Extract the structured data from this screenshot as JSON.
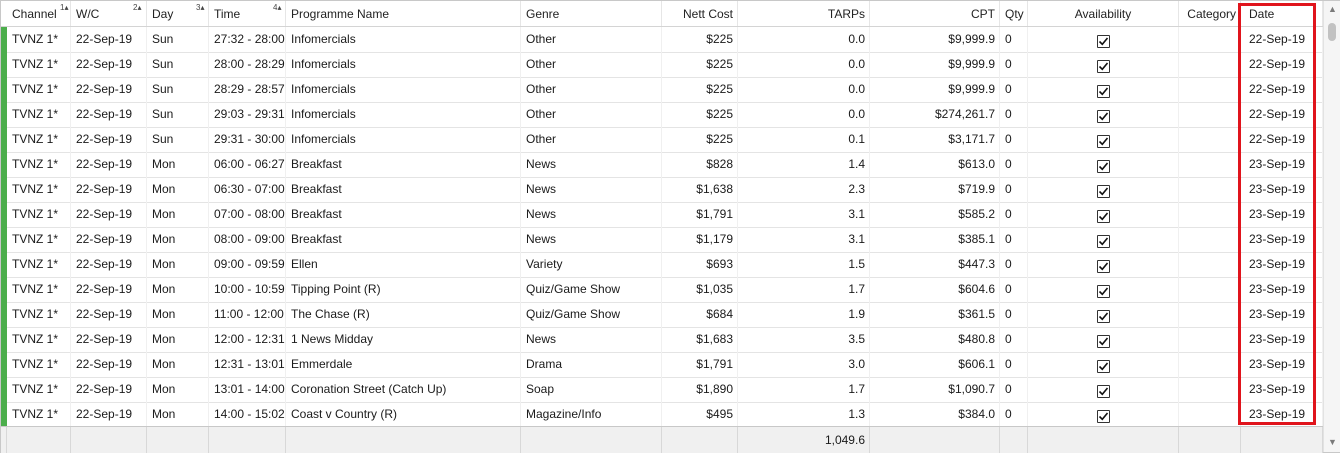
{
  "columns": {
    "channel": "Channel",
    "wc": "W/C",
    "day": "Day",
    "time": "Time",
    "programme": "Programme Name",
    "genre": "Genre",
    "nett_cost": "Nett Cost",
    "tarps": "TARPs",
    "cpt": "CPT",
    "qty": "Qty",
    "availability": "Availability",
    "category": "Category",
    "date": "Date"
  },
  "sort_indices": {
    "channel": "1",
    "wc": "2",
    "day": "3",
    "time": "4"
  },
  "rows": [
    {
      "channel": "TVNZ 1*",
      "wc": "22-Sep-19",
      "day": "Sun",
      "time": "27:32 - 28:00",
      "programme": "Infomercials",
      "genre": "Other",
      "nett_cost": "$225",
      "tarps": "0.0",
      "cpt": "$9,999.9",
      "qty": "0",
      "available": true,
      "category": "",
      "date": "22-Sep-19"
    },
    {
      "channel": "TVNZ 1*",
      "wc": "22-Sep-19",
      "day": "Sun",
      "time": "28:00 - 28:29",
      "programme": "Infomercials",
      "genre": "Other",
      "nett_cost": "$225",
      "tarps": "0.0",
      "cpt": "$9,999.9",
      "qty": "0",
      "available": true,
      "category": "",
      "date": "22-Sep-19"
    },
    {
      "channel": "TVNZ 1*",
      "wc": "22-Sep-19",
      "day": "Sun",
      "time": "28:29 - 28:57",
      "programme": "Infomercials",
      "genre": "Other",
      "nett_cost": "$225",
      "tarps": "0.0",
      "cpt": "$9,999.9",
      "qty": "0",
      "available": true,
      "category": "",
      "date": "22-Sep-19"
    },
    {
      "channel": "TVNZ 1*",
      "wc": "22-Sep-19",
      "day": "Sun",
      "time": "29:03 - 29:31",
      "programme": "Infomercials",
      "genre": "Other",
      "nett_cost": "$225",
      "tarps": "0.0",
      "cpt": "$274,261.7",
      "qty": "0",
      "available": true,
      "category": "",
      "date": "22-Sep-19"
    },
    {
      "channel": "TVNZ 1*",
      "wc": "22-Sep-19",
      "day": "Sun",
      "time": "29:31 - 30:00",
      "programme": "Infomercials",
      "genre": "Other",
      "nett_cost": "$225",
      "tarps": "0.1",
      "cpt": "$3,171.7",
      "qty": "0",
      "available": true,
      "category": "",
      "date": "22-Sep-19"
    },
    {
      "channel": "TVNZ 1*",
      "wc": "22-Sep-19",
      "day": "Mon",
      "time": "06:00 - 06:27",
      "programme": "Breakfast",
      "genre": "News",
      "nett_cost": "$828",
      "tarps": "1.4",
      "cpt": "$613.0",
      "qty": "0",
      "available": true,
      "category": "",
      "date": "23-Sep-19"
    },
    {
      "channel": "TVNZ 1*",
      "wc": "22-Sep-19",
      "day": "Mon",
      "time": "06:30 - 07:00",
      "programme": "Breakfast",
      "genre": "News",
      "nett_cost": "$1,638",
      "tarps": "2.3",
      "cpt": "$719.9",
      "qty": "0",
      "available": true,
      "category": "",
      "date": "23-Sep-19"
    },
    {
      "channel": "TVNZ 1*",
      "wc": "22-Sep-19",
      "day": "Mon",
      "time": "07:00 - 08:00",
      "programme": "Breakfast",
      "genre": "News",
      "nett_cost": "$1,791",
      "tarps": "3.1",
      "cpt": "$585.2",
      "qty": "0",
      "available": true,
      "category": "",
      "date": "23-Sep-19"
    },
    {
      "channel": "TVNZ 1*",
      "wc": "22-Sep-19",
      "day": "Mon",
      "time": "08:00 - 09:00",
      "programme": "Breakfast",
      "genre": "News",
      "nett_cost": "$1,179",
      "tarps": "3.1",
      "cpt": "$385.1",
      "qty": "0",
      "available": true,
      "category": "",
      "date": "23-Sep-19"
    },
    {
      "channel": "TVNZ 1*",
      "wc": "22-Sep-19",
      "day": "Mon",
      "time": "09:00 - 09:59",
      "programme": "Ellen",
      "genre": "Variety",
      "nett_cost": "$693",
      "tarps": "1.5",
      "cpt": "$447.3",
      "qty": "0",
      "available": true,
      "category": "",
      "date": "23-Sep-19"
    },
    {
      "channel": "TVNZ 1*",
      "wc": "22-Sep-19",
      "day": "Mon",
      "time": "10:00 - 10:59",
      "programme": "Tipping Point (R)",
      "genre": "Quiz/Game Show",
      "nett_cost": "$1,035",
      "tarps": "1.7",
      "cpt": "$604.6",
      "qty": "0",
      "available": true,
      "category": "",
      "date": "23-Sep-19"
    },
    {
      "channel": "TVNZ 1*",
      "wc": "22-Sep-19",
      "day": "Mon",
      "time": "11:00 - 12:00",
      "programme": "The Chase (R)",
      "genre": "Quiz/Game Show",
      "nett_cost": "$684",
      "tarps": "1.9",
      "cpt": "$361.5",
      "qty": "0",
      "available": true,
      "category": "",
      "date": "23-Sep-19"
    },
    {
      "channel": "TVNZ 1*",
      "wc": "22-Sep-19",
      "day": "Mon",
      "time": "12:00 - 12:31",
      "programme": "1 News Midday",
      "genre": "News",
      "nett_cost": "$1,683",
      "tarps": "3.5",
      "cpt": "$480.8",
      "qty": "0",
      "available": true,
      "category": "",
      "date": "23-Sep-19"
    },
    {
      "channel": "TVNZ 1*",
      "wc": "22-Sep-19",
      "day": "Mon",
      "time": "12:31 - 13:01",
      "programme": "Emmerdale",
      "genre": "Drama",
      "nett_cost": "$1,791",
      "tarps": "3.0",
      "cpt": "$606.1",
      "qty": "0",
      "available": true,
      "category": "",
      "date": "23-Sep-19"
    },
    {
      "channel": "TVNZ 1*",
      "wc": "22-Sep-19",
      "day": "Mon",
      "time": "13:01 - 14:00",
      "programme": "Coronation Street (Catch Up)",
      "genre": "Soap",
      "nett_cost": "$1,890",
      "tarps": "1.7",
      "cpt": "$1,090.7",
      "qty": "0",
      "available": true,
      "category": "",
      "date": "23-Sep-19"
    },
    {
      "channel": "TVNZ 1*",
      "wc": "22-Sep-19",
      "day": "Mon",
      "time": "14:00 - 15:02",
      "programme": "Coast v Country (R)",
      "genre": "Magazine/Info",
      "nett_cost": "$495",
      "tarps": "1.3",
      "cpt": "$384.0",
      "qty": "0",
      "available": true,
      "category": "",
      "date": "23-Sep-19"
    }
  ],
  "footer": {
    "tarps_total": "1,049.6"
  },
  "highlight_color": "#e0141c",
  "row_marker_color": "#4cae4c"
}
